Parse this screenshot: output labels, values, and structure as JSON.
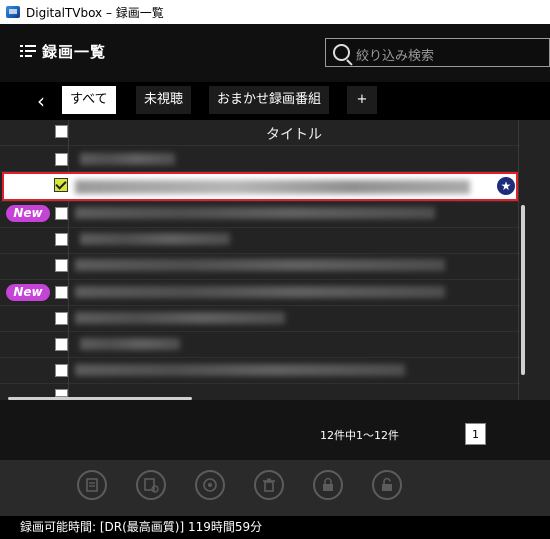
{
  "window": {
    "title": "DigitalTVbox – 録画一覧"
  },
  "header": {
    "title": "録画一覧",
    "search_placeholder": "絞り込み検索"
  },
  "tabs": [
    {
      "label": "すべて",
      "active": true
    },
    {
      "label": "未視聴",
      "active": false
    },
    {
      "label": "おまかせ録画番組",
      "active": false
    },
    {
      "label": "+",
      "active": false
    }
  ],
  "list": {
    "column_title": "タイトル",
    "new_badge": "New"
  },
  "pager": {
    "count_text": "12件中1〜12件",
    "current_page": "1"
  },
  "status": {
    "text": "録画可能時間: [DR(最高画質)] 119時間59分"
  },
  "colors": {
    "accent_red": "#e0202a",
    "new_badge": "#c543d6",
    "selected_checkbox": "#d7e63a",
    "star_badge": "#1e2d7a"
  },
  "icons": [
    "menu-icon",
    "search-icon",
    "back-arrow-icon",
    "star-icon",
    "edit-icon",
    "dub-icon",
    "disc-icon",
    "trash-icon",
    "lock-icon",
    "unlock-icon"
  ]
}
